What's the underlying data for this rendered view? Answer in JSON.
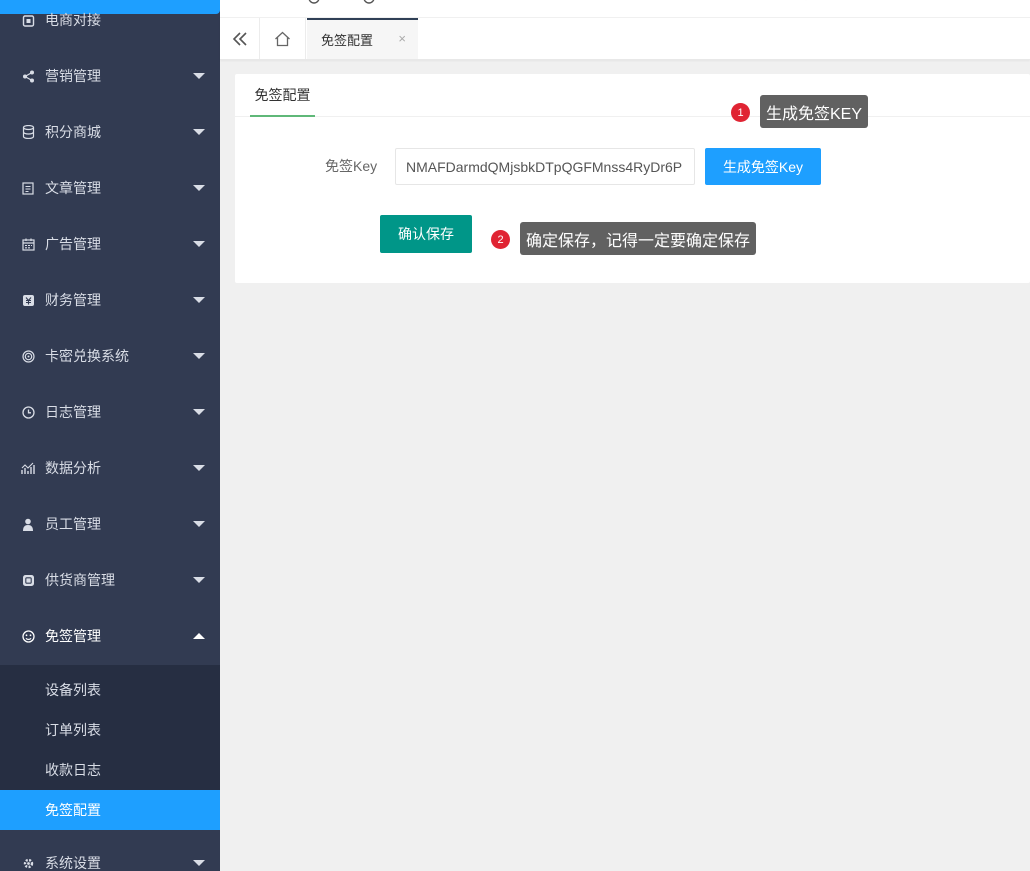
{
  "sidebar": {
    "items": [
      {
        "label": "电商对接",
        "icon": "store-icon"
      },
      {
        "label": "营销管理",
        "icon": "share-icon"
      },
      {
        "label": "积分商城",
        "icon": "database-icon"
      },
      {
        "label": "文章管理",
        "icon": "article-icon"
      },
      {
        "label": "广告管理",
        "icon": "calendar-icon"
      },
      {
        "label": "财务管理",
        "icon": "finance-icon"
      },
      {
        "label": "卡密兑换系统",
        "icon": "fingerprint-icon"
      },
      {
        "label": "日志管理",
        "icon": "clock-icon"
      },
      {
        "label": "数据分析",
        "icon": "chart-icon"
      },
      {
        "label": "员工管理",
        "icon": "user-icon"
      },
      {
        "label": "供货商管理",
        "icon": "supplier-icon"
      },
      {
        "label": "免签管理",
        "icon": "face-icon"
      },
      {
        "label": "系统设置",
        "icon": "gear-icon"
      }
    ],
    "submenu": [
      {
        "label": "设备列表"
      },
      {
        "label": "订单列表"
      },
      {
        "label": "收款日志"
      },
      {
        "label": "免签配置"
      }
    ]
  },
  "tabs": {
    "active_label": "免签配置",
    "close_glyph": "×"
  },
  "card": {
    "tab_label": "免签配置",
    "key_label": "免签Key",
    "key_value": "NMAFDarmdQMjsbkDTpQGFMnss4RyDr6P",
    "generate_button": "生成免签Key",
    "save_button": "确认保存"
  },
  "annotations": [
    {
      "number": "1",
      "text": "生成免签KEY"
    },
    {
      "number": "2",
      "text": "确定保存，记得一定要确定保存"
    }
  ],
  "colors": {
    "sidebar_bg": "#323b52",
    "submenu_bg": "#262e42",
    "accent_blue": "#1e9fff",
    "save_green": "#009688",
    "tab_underline": "#5fb878",
    "badge_red": "#e02433"
  }
}
